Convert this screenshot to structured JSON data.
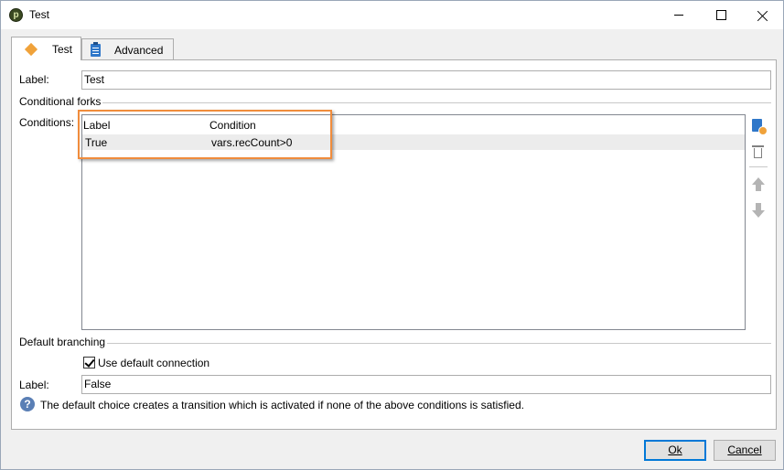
{
  "window": {
    "title": "Test"
  },
  "tabs": [
    {
      "label": "Test",
      "icon": "diamond-icon",
      "active": true
    },
    {
      "label": "Advanced",
      "icon": "clipboard-icon",
      "active": false
    }
  ],
  "form": {
    "label_caption": "Label:",
    "label_value": "Test",
    "conditional_forks_title": "Conditional forks",
    "conditions_caption": "Conditions:",
    "columns": [
      "Label",
      "Condition"
    ],
    "rows": [
      {
        "label": "True",
        "condition": "vars.recCount>0"
      }
    ],
    "default_branching_title": "Default branching",
    "use_default_label": "Use default connection",
    "use_default_checked": true,
    "default_label_caption": "Label:",
    "default_label_value": "False",
    "help_text": "The default choice creates a transition which is activated if none of the above conditions is satisfied."
  },
  "buttons": {
    "ok": "Ok",
    "cancel": "Cancel"
  },
  "colors": {
    "highlight": "#f08c3c",
    "accent": "#0078d7"
  }
}
